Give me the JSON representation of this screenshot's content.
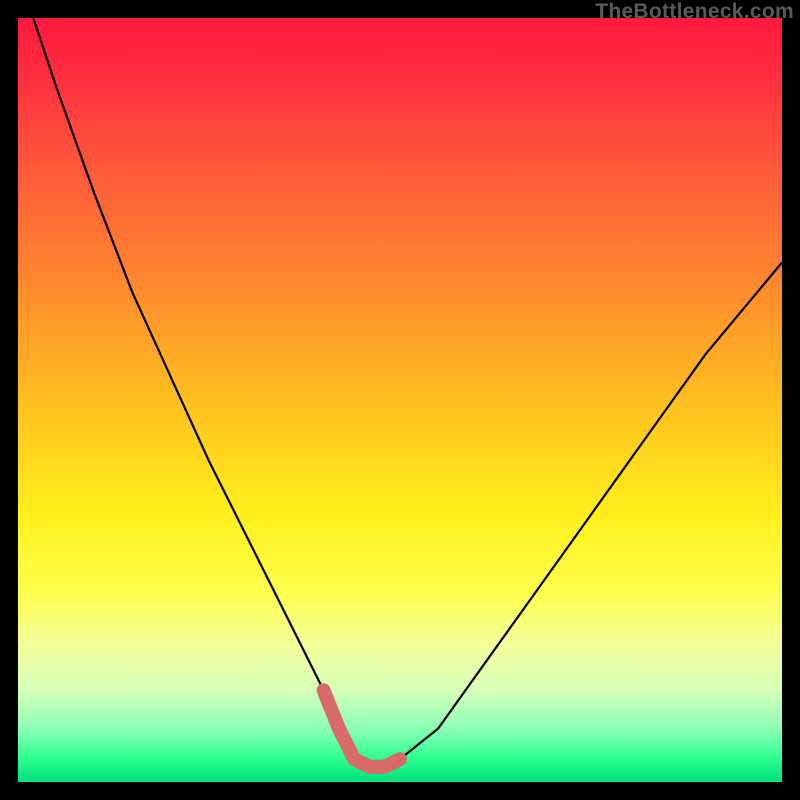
{
  "watermark": "TheBottleneck.com",
  "chart_data": {
    "type": "line",
    "title": "",
    "xlabel": "",
    "ylabel": "",
    "xlim": [
      0,
      100
    ],
    "ylim": [
      0,
      100
    ],
    "series": [
      {
        "name": "bottleneck-curve",
        "x": [
          2,
          5,
          10,
          15,
          20,
          25,
          30,
          35,
          40,
          42,
          44,
          46,
          48,
          50,
          55,
          60,
          65,
          70,
          75,
          80,
          85,
          90,
          95,
          100
        ],
        "values": [
          100,
          91,
          77,
          64,
          53,
          42,
          32,
          22,
          12,
          7,
          3,
          2,
          2,
          3,
          7,
          14,
          21,
          28,
          35,
          42,
          49,
          56,
          62,
          68
        ]
      }
    ],
    "annotations": [
      {
        "name": "trough-highlight",
        "x_start": 40,
        "x_end": 50,
        "y": 2,
        "color": "#d86a6a"
      }
    ],
    "gradient_stops": [
      {
        "pos": 0,
        "color": "#ff1a3e"
      },
      {
        "pos": 20,
        "color": "#ff5a3a"
      },
      {
        "pos": 52,
        "color": "#ffc51f"
      },
      {
        "pos": 75,
        "color": "#fdff4c"
      },
      {
        "pos": 93,
        "color": "#8cffb5"
      },
      {
        "pos": 100,
        "color": "#00e07a"
      }
    ]
  }
}
